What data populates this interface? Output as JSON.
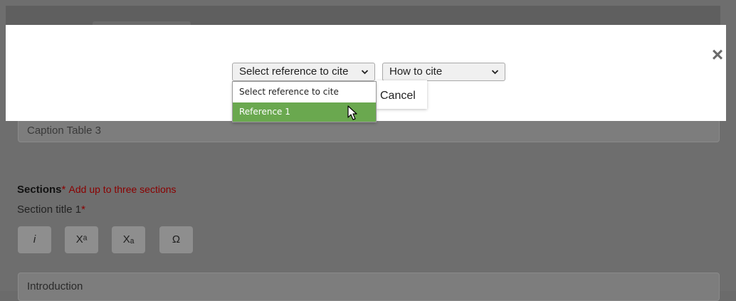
{
  "background": {
    "caption_placeholder": "Caption Table 3",
    "sections_heading": "Sections",
    "sections_required_mark": "*",
    "sections_hint": "Add up to three sections",
    "section_title_label": "Section title 1",
    "section_title_required_mark": "*",
    "format_buttons": [
      "i",
      "Xᵃ",
      "Xₐ",
      "Ω"
    ],
    "intro_field_value": "Introduction"
  },
  "modal": {
    "close_glyph": "×",
    "reference_select": {
      "value": "Select reference to cite",
      "options": [
        "Select reference to cite",
        "Reference 1"
      ],
      "highlighted_option": "Reference 1"
    },
    "how_to_cite_select": {
      "value": "How to cite"
    },
    "cancel_label": "Cancel"
  },
  "colors": {
    "highlight": "#6aa84f",
    "overlay": "#6e6e6e",
    "required": "#8a0000"
  },
  "icons": {
    "close": "close-icon",
    "dropdown_arrow": "chevron-down-icon",
    "pointer": "mouse-cursor-icon"
  }
}
